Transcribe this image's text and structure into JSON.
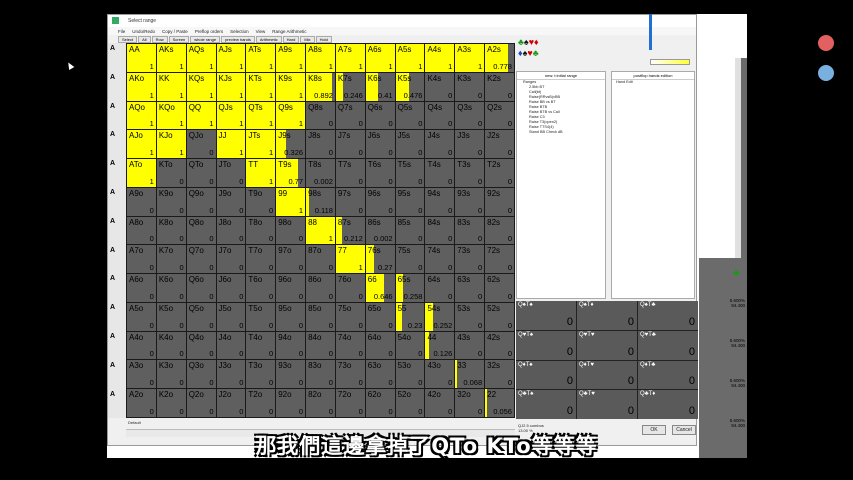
{
  "window": {
    "title": "Select range",
    "menu": [
      "File",
      "Undo/Redo",
      "Copy / Paste",
      "Preflop orders",
      "Selection",
      "View",
      "Range Arithmetic"
    ],
    "toolbar": [
      "Select",
      "All",
      "Row",
      "Screen",
      "whole range",
      "preview hands",
      "Arithmetic",
      "Hard",
      "Mix",
      "Hold"
    ]
  },
  "grid": {
    "rows": [
      [
        "AA",
        "AKs",
        "AQs",
        "AJs",
        "ATs",
        "A9s",
        "A8s",
        "A7s",
        "A6s",
        "A5s",
        "A4s",
        "A3s",
        "A2s"
      ],
      [
        "AKo",
        "KK",
        "KQs",
        "KJs",
        "KTs",
        "K9s",
        "K8s",
        "K7s",
        "K6s",
        "K5s",
        "K4s",
        "K3s",
        "K2s"
      ],
      [
        "AQo",
        "KQo",
        "QQ",
        "QJs",
        "QTs",
        "Q9s",
        "Q8s",
        "Q7s",
        "Q6s",
        "Q5s",
        "Q4s",
        "Q3s",
        "Q2s"
      ],
      [
        "AJo",
        "KJo",
        "QJo",
        "JJ",
        "JTs",
        "J9s",
        "J8s",
        "J7s",
        "J6s",
        "J5s",
        "J4s",
        "J3s",
        "J2s"
      ],
      [
        "ATo",
        "KTo",
        "QTo",
        "JTo",
        "TT",
        "T9s",
        "T8s",
        "T7s",
        "T6s",
        "T5s",
        "T4s",
        "T3s",
        "T2s"
      ],
      [
        "A9o",
        "K9o",
        "Q9o",
        "J9o",
        "T9o",
        "99",
        "98s",
        "97s",
        "96s",
        "95s",
        "94s",
        "93s",
        "92s"
      ],
      [
        "A8o",
        "K8o",
        "Q8o",
        "J8o",
        "T8o",
        "98o",
        "88",
        "87s",
        "86s",
        "85s",
        "84s",
        "83s",
        "82s"
      ],
      [
        "A7o",
        "K7o",
        "Q7o",
        "J7o",
        "T7o",
        "97o",
        "87o",
        "77",
        "76s",
        "75s",
        "74s",
        "73s",
        "72s"
      ],
      [
        "A6o",
        "K6o",
        "Q6o",
        "J6o",
        "T6o",
        "96o",
        "86o",
        "76o",
        "66",
        "65s",
        "64s",
        "63s",
        "62s"
      ],
      [
        "A5o",
        "K5o",
        "Q5o",
        "J5o",
        "T5o",
        "95o",
        "85o",
        "75o",
        "65o",
        "55",
        "54s",
        "53s",
        "52s"
      ],
      [
        "A4o",
        "K4o",
        "Q4o",
        "J4o",
        "T4o",
        "94o",
        "84o",
        "74o",
        "64o",
        "54o",
        "44",
        "43s",
        "42s"
      ],
      [
        "A3o",
        "K3o",
        "Q3o",
        "J3o",
        "T3o",
        "93o",
        "83o",
        "73o",
        "63o",
        "53o",
        "43o",
        "33",
        "32s"
      ],
      [
        "A2o",
        "K2o",
        "Q2o",
        "J2o",
        "T2o",
        "92o",
        "82o",
        "72o",
        "62o",
        "52o",
        "42o",
        "32o",
        "22"
      ]
    ],
    "values": [
      [
        "1",
        "1",
        "1",
        "1",
        "1",
        "1",
        "1",
        "1",
        "1",
        "1",
        "1",
        "1",
        "0.778"
      ],
      [
        "1",
        "1",
        "1",
        "1",
        "1",
        "1",
        "0.892",
        "0.246",
        "0.41",
        "0.476",
        "0",
        "0",
        "0"
      ],
      [
        "1",
        "1",
        "1",
        "1",
        "1",
        "1",
        "0",
        "0",
        "0",
        "0",
        "0",
        "0",
        "0"
      ],
      [
        "1",
        "1",
        "0",
        "1",
        "1",
        "0.326",
        "0",
        "0",
        "0",
        "0",
        "0",
        "0",
        "0"
      ],
      [
        "1",
        "0",
        "0",
        "0",
        "1",
        "0.77",
        "0.002",
        "0",
        "0",
        "0",
        "0",
        "0",
        "0"
      ],
      [
        "0",
        "0",
        "0",
        "0",
        "0",
        "1",
        "0.118",
        "0",
        "0",
        "0",
        "0",
        "0",
        "0"
      ],
      [
        "0",
        "0",
        "0",
        "0",
        "0",
        "0",
        "1",
        "0.212",
        "0.002",
        "0",
        "0",
        "0",
        "0"
      ],
      [
        "0",
        "0",
        "0",
        "0",
        "0",
        "0",
        "0",
        "1",
        "0.27",
        "0",
        "0",
        "0",
        "0"
      ],
      [
        "0",
        "0",
        "0",
        "0",
        "0",
        "0",
        "0",
        "0",
        "0.646",
        "0.258",
        "0",
        "0",
        "0"
      ],
      [
        "0",
        "0",
        "0",
        "0",
        "0",
        "0",
        "0",
        "0",
        "0",
        "0.23",
        "0.252",
        "0",
        "0"
      ],
      [
        "0",
        "0",
        "0",
        "0",
        "0",
        "0",
        "0",
        "0",
        "0",
        "0",
        "0.126",
        "0",
        "0"
      ],
      [
        "0",
        "0",
        "0",
        "0",
        "0",
        "0",
        "0",
        "0",
        "0",
        "0",
        "0",
        "0.068",
        "0"
      ],
      [
        "0",
        "0",
        "0",
        "0",
        "0",
        "0",
        "0",
        "0",
        "0",
        "0",
        "0",
        "0",
        "0.056"
      ]
    ]
  },
  "left_tabs": [
    "A",
    "A",
    "A",
    "A",
    "A",
    "A",
    "A",
    "A",
    "A",
    "A",
    "A",
    "A",
    "A"
  ],
  "status": "Default",
  "tree": {
    "header": "new: t:initial range",
    "items": [
      "Ranges",
      "2.5bb BT",
      "Call(bt)",
      "Raise(RRvsB)vBB",
      "Raise BB vs BT",
      "Raise BTB",
      "Raise BTB vs Call",
      "Raise C3",
      "Raise T3(open2)",
      "Raise TTS4(4)",
      "Stand BB Check dB"
    ]
  },
  "post": {
    "header": "postflop hands edition",
    "items": [
      "Hand Edit"
    ]
  },
  "combos": [
    {
      "name": "Q♠T♠",
      "value": "0"
    },
    {
      "name": "Q♠T♦",
      "value": "0"
    },
    {
      "name": "Q♠T♣",
      "value": "0"
    },
    {
      "name": "Q♥T♠",
      "value": "0"
    },
    {
      "name": "Q♥T♥",
      "value": "0"
    },
    {
      "name": "Q♥T♣",
      "value": "0"
    },
    {
      "name": "Q♦T♠",
      "value": "0"
    },
    {
      "name": "Q♦T♥",
      "value": "0"
    },
    {
      "name": "Q♦T♣",
      "value": "0"
    },
    {
      "name": "Q♣T♠",
      "value": "0"
    },
    {
      "name": "Q♣T♥",
      "value": "0"
    },
    {
      "name": "Q♣T♦",
      "value": "0"
    }
  ],
  "footer": {
    "info": "QJ2.5 combos",
    "sub": "13.00 %",
    "ok": "OK",
    "cancel": "Cancel"
  },
  "right_percent": [
    {
      "a": "5.600%",
      "b": "94.400"
    },
    {
      "a": "5.600%",
      "b": "94.400"
    },
    {
      "a": "5.600%",
      "b": "94.400"
    },
    {
      "a": "5.600%",
      "b": "94.400"
    }
  ],
  "subtitle": "那我們這邊拿掉了QTo KTo等等等"
}
